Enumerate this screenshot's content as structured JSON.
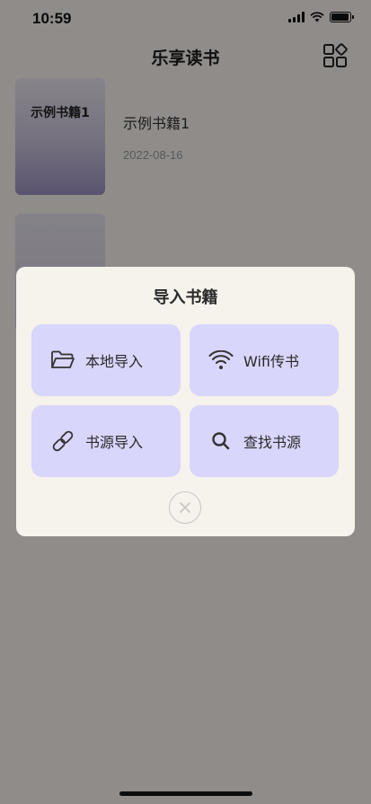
{
  "status": {
    "time": "10:59",
    "battery_level": 0.85
  },
  "nav": {
    "title": "乐享读书",
    "grid_icon": "grid-icon"
  },
  "books": [
    {
      "cover_title": "示例书籍1",
      "name": "示例书籍1",
      "date": "2022-08-16"
    }
  ],
  "dialog": {
    "title": "导入书籍",
    "options": [
      {
        "label": "本地导入",
        "icon": "folder-icon"
      },
      {
        "label": "Wifi传书",
        "icon": "wifi-icon"
      },
      {
        "label": "书源导入",
        "icon": "link-icon"
      },
      {
        "label": "查找书源",
        "icon": "search-icon"
      }
    ],
    "close_icon": "close-icon"
  },
  "colors": {
    "option_bg": "#d8d6fb",
    "dialog_bg": "#f6f2ec",
    "overlay": "#8f8e8a"
  }
}
